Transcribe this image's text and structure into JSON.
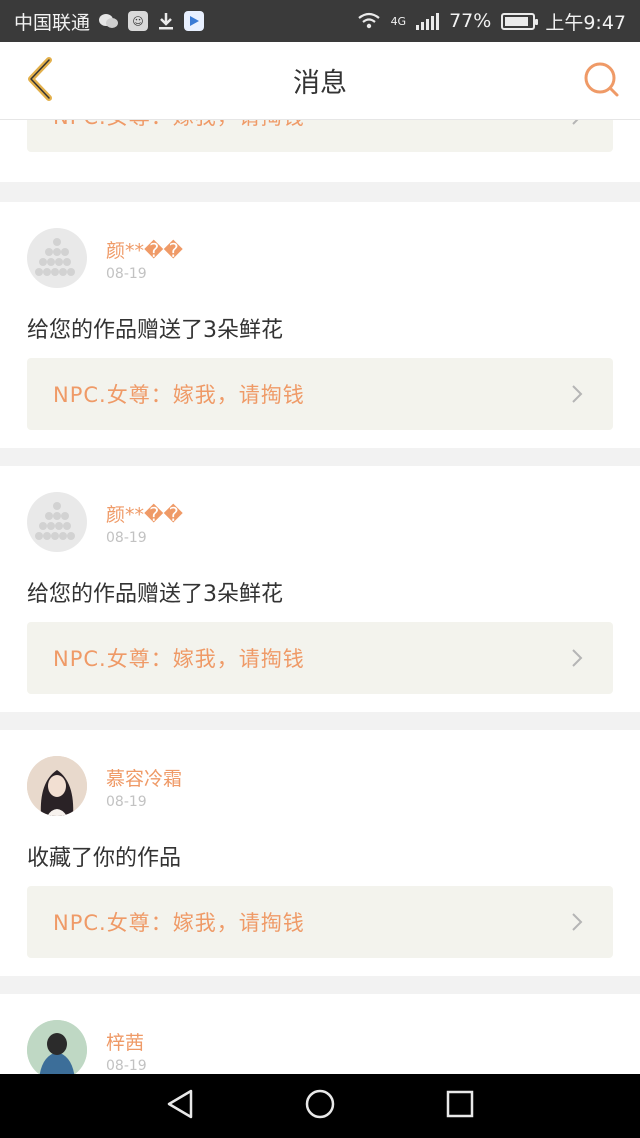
{
  "status_bar": {
    "carrier": "中国联通",
    "network": "4G",
    "battery_percent": "77%",
    "time": "上午9:47",
    "icons": [
      "wechat-icon",
      "chat-app-icon",
      "download-icon",
      "video-app-icon",
      "wifi-icon",
      "signal-icon",
      "battery-icon"
    ]
  },
  "header": {
    "title": "消息",
    "back_icon": "chevron-left-icon",
    "search_icon": "search-icon"
  },
  "colors": {
    "accent": "#ef9a67",
    "quote_bg": "#f3f3ed",
    "text": "#333333",
    "date": "#c2c2c2"
  },
  "messages": [
    {
      "quote": "NPC.女尊：嫁我，请掏钱"
    },
    {
      "user": "颜**��",
      "date": "08-19",
      "action": "给您的作品赠送了3朵鲜花",
      "quote": "NPC.女尊：嫁我，请掏钱"
    },
    {
      "user": "颜**��",
      "date": "08-19",
      "action": "给您的作品赠送了3朵鲜花",
      "quote": "NPC.女尊：嫁我，请掏钱"
    },
    {
      "user": "慕容冷霜",
      "date": "08-19",
      "action": "收藏了你的作品",
      "quote": "NPC.女尊：嫁我，请掏钱"
    },
    {
      "user": "梓茜",
      "date": "08-19"
    }
  ],
  "nav_bar": {
    "icons": [
      "back-triangle-icon",
      "home-circle-icon",
      "recents-square-icon"
    ]
  }
}
